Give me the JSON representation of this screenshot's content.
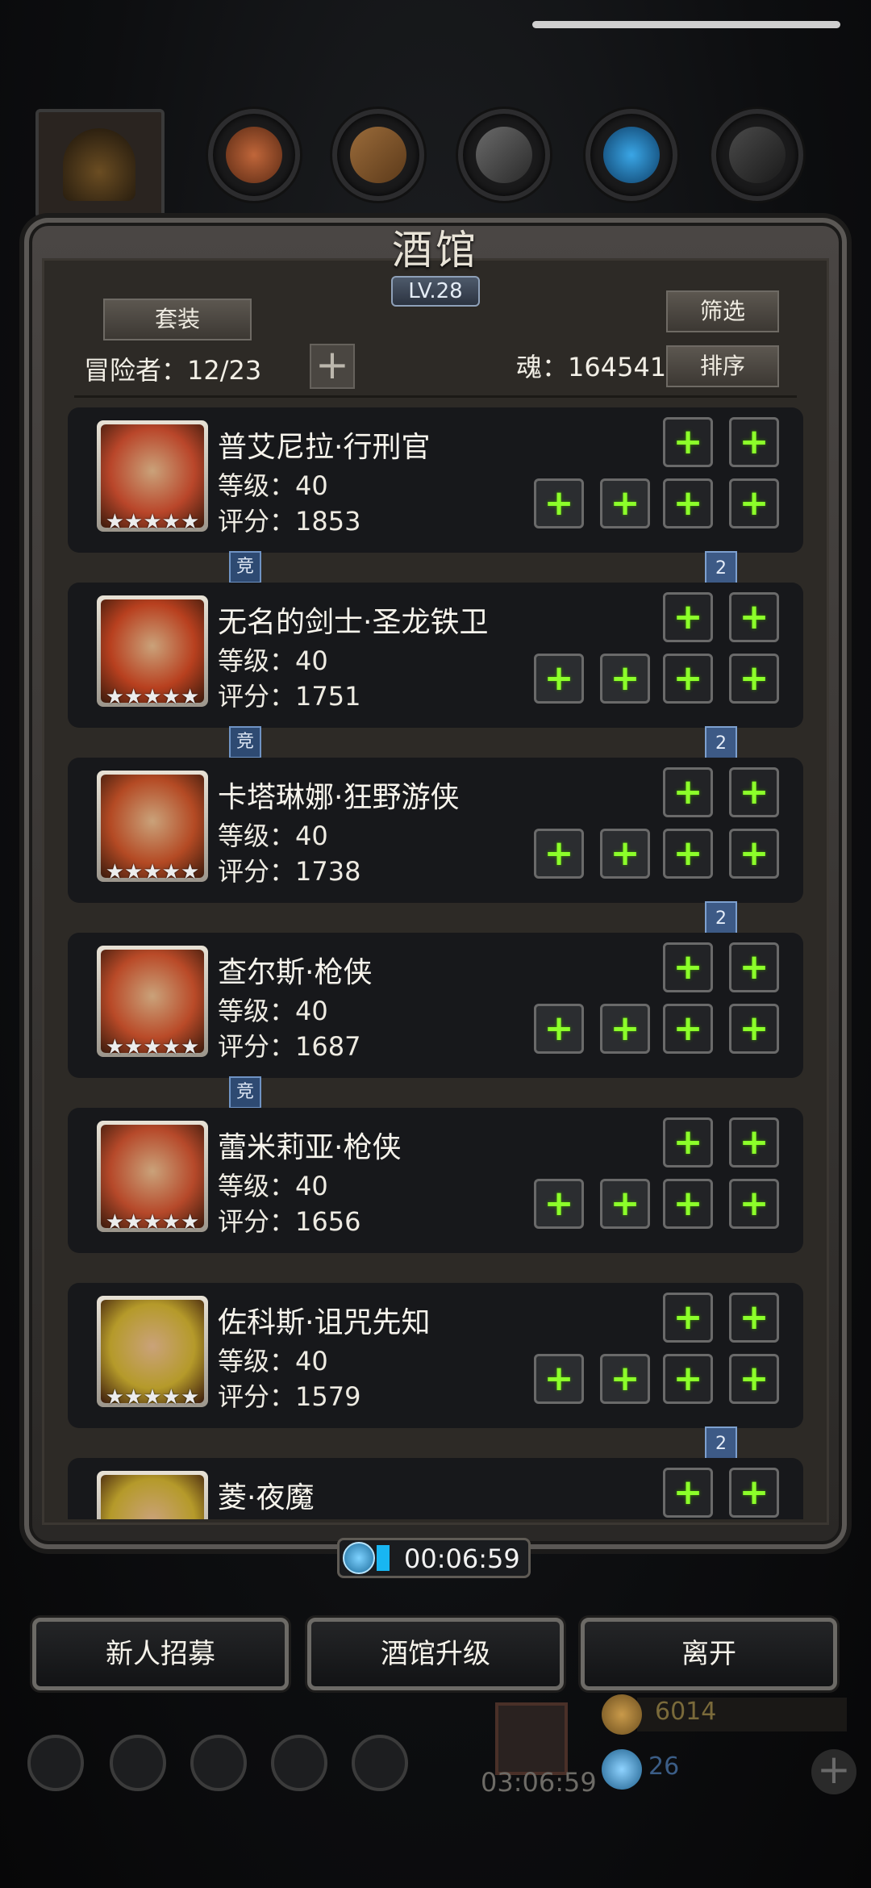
{
  "header": {
    "title": "酒馆",
    "level": "LV.28"
  },
  "toolbar": {
    "set_label": "套装",
    "filter_label": "筛选",
    "sort_label": "排序",
    "adventurers": "冒险者：12/23",
    "soul": "魂：164541",
    "add_icon": "plus-icon"
  },
  "heroes": [
    {
      "name": "普艾尼拉·行刑官",
      "level": "等级：40",
      "score": "评分：1853",
      "stars": "★★★★★",
      "portrait_color": "#b9462a",
      "below_badges": [
        "竞",
        "2"
      ]
    },
    {
      "name": "无名的剑士·圣龙铁卫",
      "level": "等级：40",
      "score": "评分：1751",
      "stars": "★★★★★",
      "portrait_color": "#b8401f",
      "below_badges": [
        "竞",
        "2"
      ]
    },
    {
      "name": "卡塔琳娜·狂野游侠",
      "level": "等级：40",
      "score": "评分：1738",
      "stars": "★★★★★",
      "portrait_color": "#b44a24",
      "below_badges": [
        "2"
      ]
    },
    {
      "name": "查尔斯·枪侠",
      "level": "等级：40",
      "score": "评分：1687",
      "stars": "★★★★★",
      "portrait_color": "#b94a28",
      "below_badges": [
        "竞"
      ]
    },
    {
      "name": "蕾米莉亚·枪侠",
      "level": "等级：40",
      "score": "评分：1656",
      "stars": "★★★★★",
      "portrait_color": "#b6492a",
      "below_badges": []
    },
    {
      "name": "佐科斯·诅咒先知",
      "level": "等级：40",
      "score": "评分：1579",
      "stars": "★★★★★",
      "portrait_color": "#b59a2a",
      "below_badges": [
        "2"
      ]
    },
    {
      "name": "菱·夜魔",
      "level": "",
      "score": "",
      "stars": "",
      "portrait_color": "#b59a2a",
      "below_badges": []
    }
  ],
  "timer": {
    "value": "00:06:59"
  },
  "actions": {
    "recruit": "新人招募",
    "upgrade": "酒馆升级",
    "leave": "离开"
  },
  "footer": {
    "gift_timer": "03:06:59",
    "coins": "6014",
    "gems": "26"
  },
  "colors": {
    "accent_green": "#8cff2a",
    "badge_blue": "#3d5a86",
    "panel": "#2d2a26",
    "card": "#17181b"
  }
}
